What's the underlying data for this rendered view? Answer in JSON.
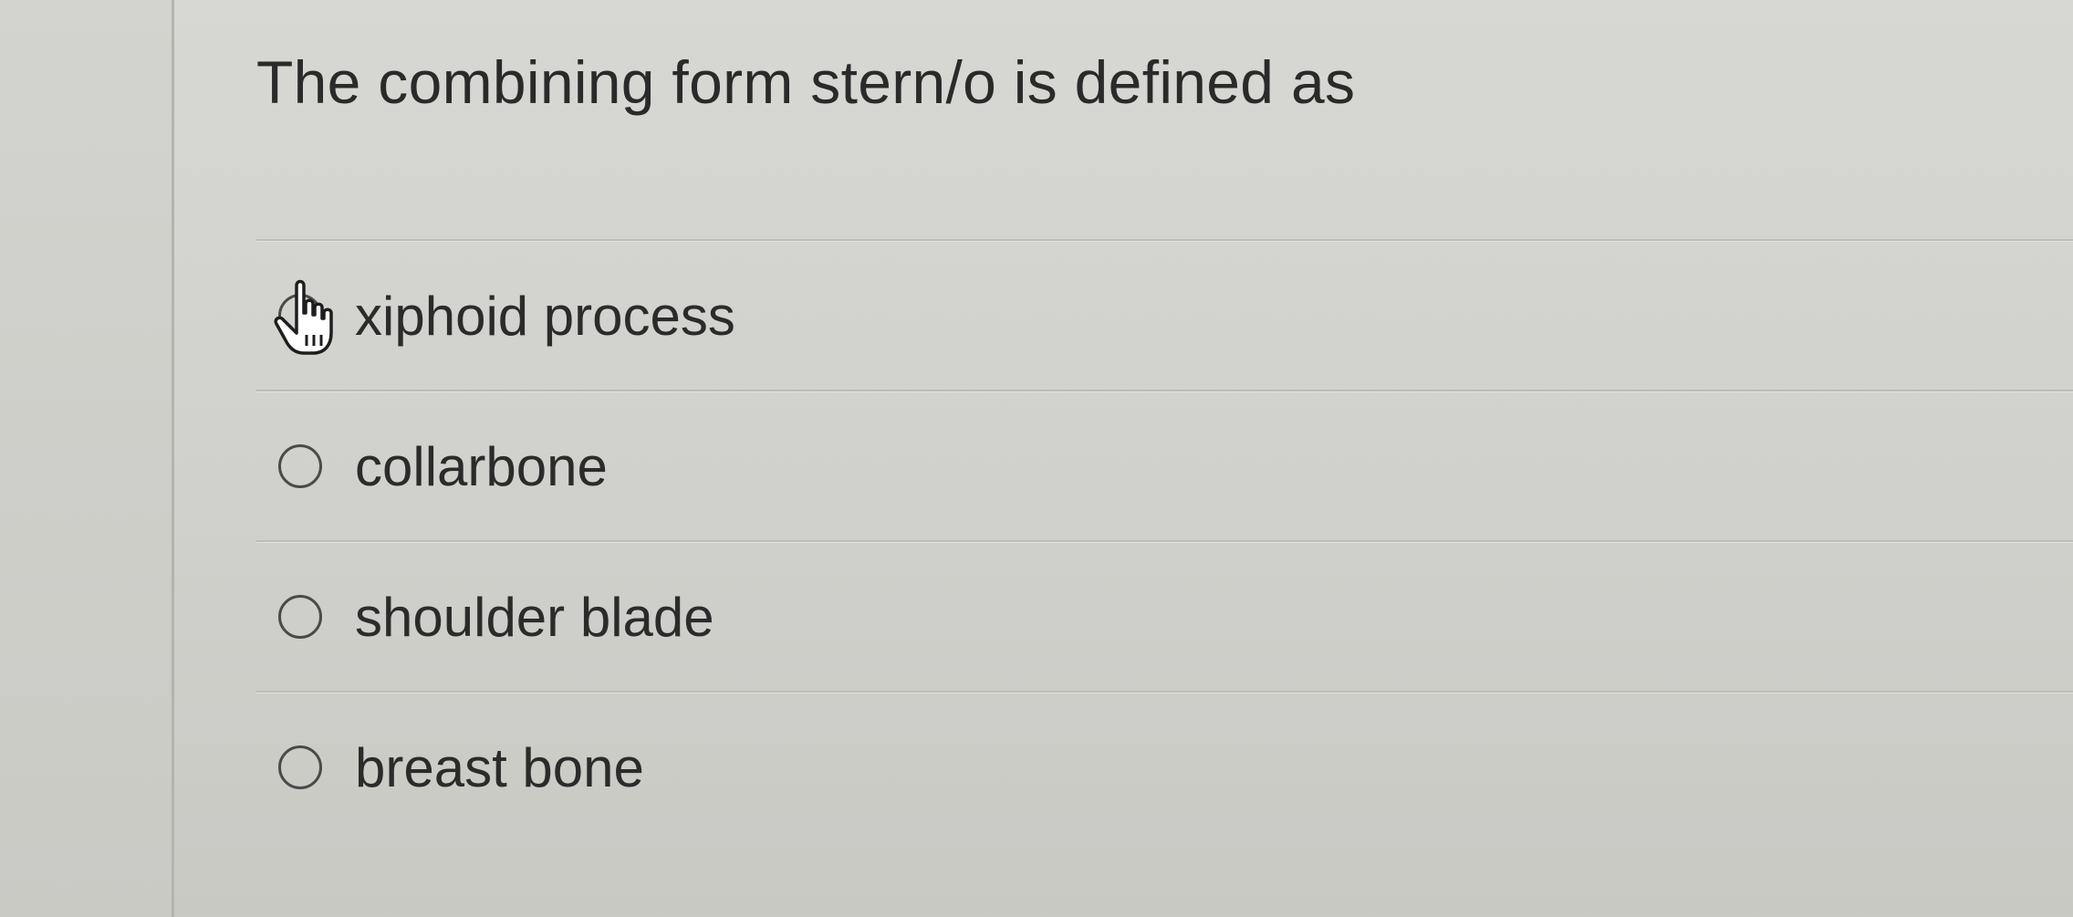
{
  "question": {
    "text": "The combining form stern/o is defined as"
  },
  "answers": [
    {
      "label": "xiphoid process",
      "selected": false,
      "hovered": true
    },
    {
      "label": "collarbone",
      "selected": false,
      "hovered": false
    },
    {
      "label": "shoulder blade",
      "selected": false,
      "hovered": false
    },
    {
      "label": "breast bone",
      "selected": false,
      "hovered": false
    }
  ],
  "cursor": {
    "icon": "hand-pointer-icon"
  }
}
